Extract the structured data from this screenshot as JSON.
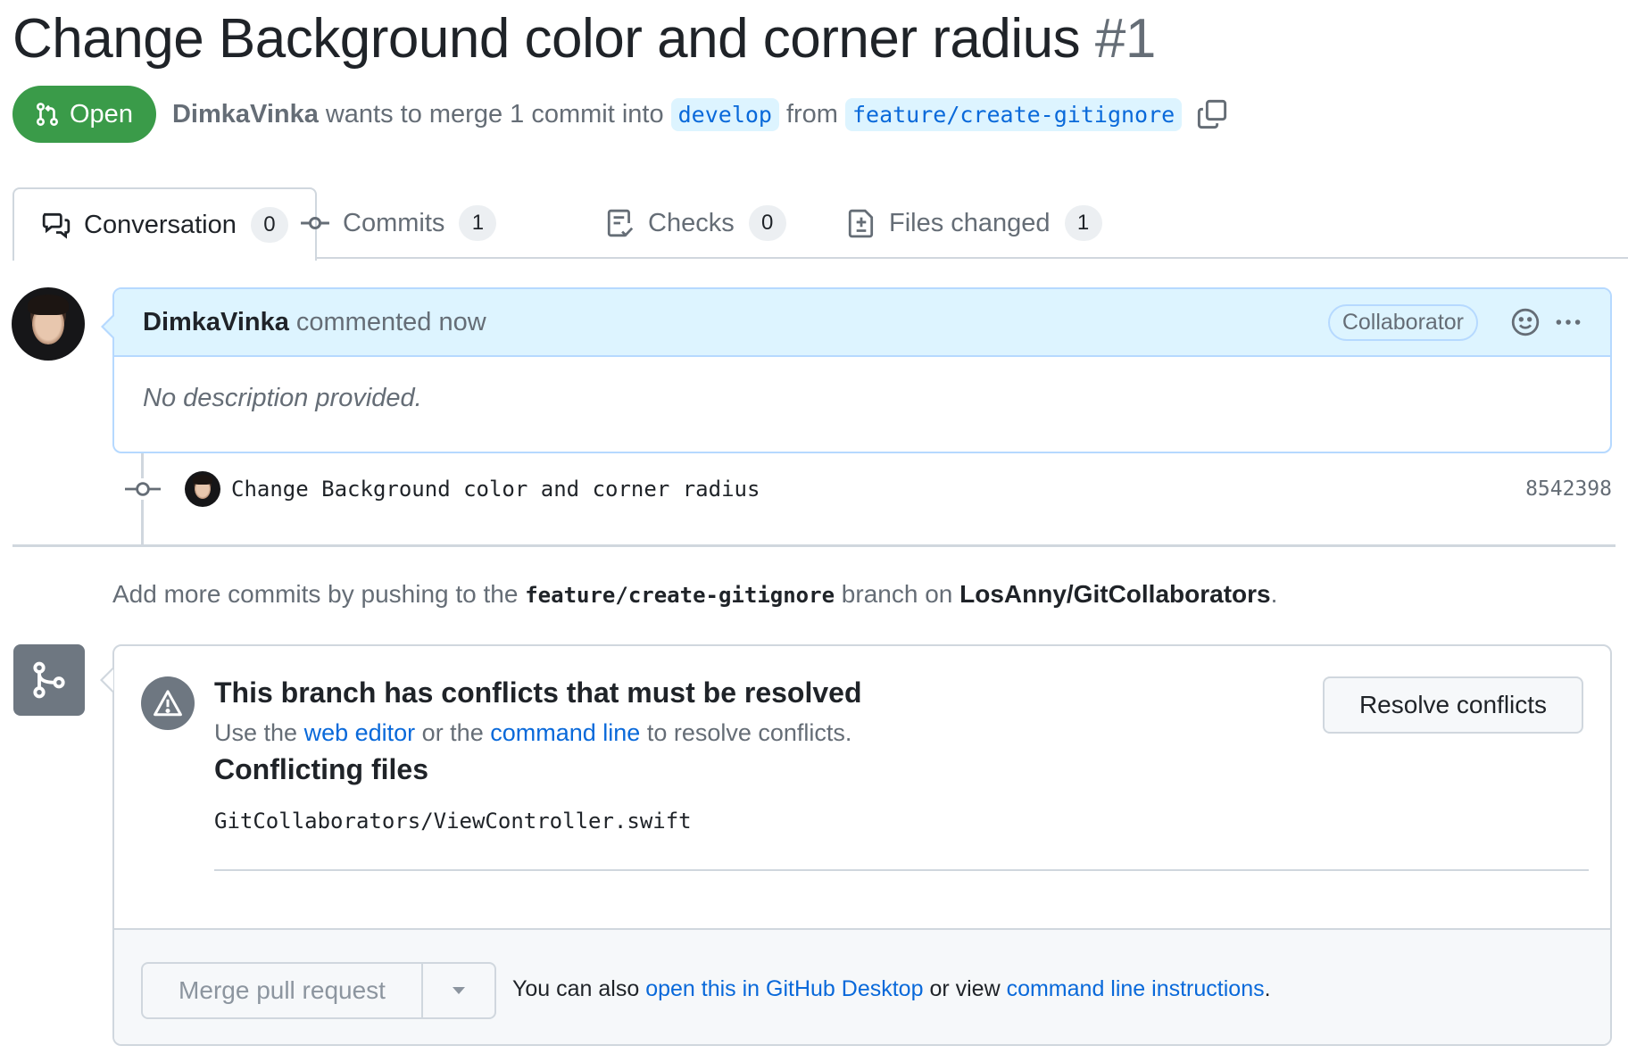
{
  "pr": {
    "title": "Change Background color and corner radius",
    "number": "#1",
    "state": "Open",
    "author": "DimkaVinka",
    "merge_text_1": "wants to merge 1 commit into",
    "base_branch": "develop",
    "merge_text_2": "from",
    "head_branch": "feature/create-gitignore"
  },
  "tabs": [
    {
      "label": "Conversation",
      "count": "0",
      "icon": "comment-discussion-icon"
    },
    {
      "label": "Commits",
      "count": "1",
      "icon": "git-commit-icon"
    },
    {
      "label": "Checks",
      "count": "0",
      "icon": "checklist-icon"
    },
    {
      "label": "Files changed",
      "count": "1",
      "icon": "file-diff-icon"
    }
  ],
  "comment": {
    "author": "DimkaVinka",
    "action": "commented now",
    "role": "Collaborator",
    "body": "No description provided."
  },
  "commit": {
    "message": "Change Background color and corner radius",
    "sha": "8542398"
  },
  "push_hint": {
    "prefix": "Add more commits by pushing to the",
    "branch": "feature/create-gitignore",
    "middle": "branch on",
    "repo": "LosAnny/GitCollaborators",
    "suffix": "."
  },
  "conflicts": {
    "title": "This branch has conflicts that must be resolved",
    "sub_prefix": "Use the",
    "web_editor": "web editor",
    "sub_middle": "or the",
    "command_line": "command line",
    "sub_suffix": "to resolve conflicts.",
    "files_title": "Conflicting files",
    "files": [
      "GitCollaborators/ViewController.swift"
    ],
    "resolve_button": "Resolve conflicts"
  },
  "merge_footer": {
    "merge_button": "Merge pull request",
    "text_prefix": "You can also",
    "desktop_link": "open this in GitHub Desktop",
    "text_middle": "or view",
    "cli_link": "command line instructions",
    "text_suffix": "."
  },
  "colors": {
    "open_green": "#3a9b49",
    "link_blue": "#0969da",
    "comment_header_bg": "#ddf4ff",
    "muted_text": "#656d76"
  }
}
